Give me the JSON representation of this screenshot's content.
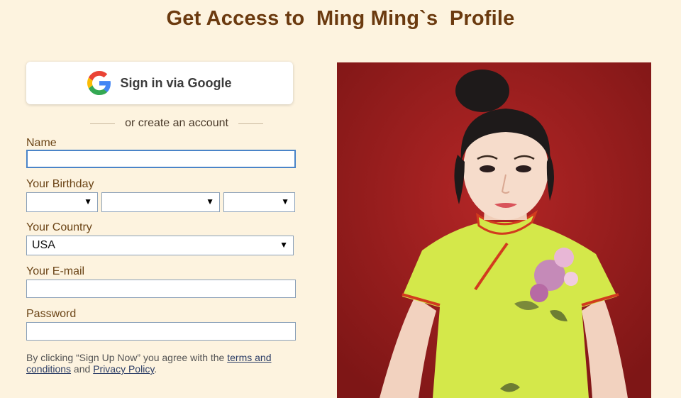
{
  "page": {
    "title": "Get Access to  Ming Ming`s  Profile"
  },
  "google": {
    "label": "Sign in via Google",
    "icon": "google-g-icon"
  },
  "divider": {
    "text": "or create an account"
  },
  "form": {
    "name": {
      "label": "Name",
      "value": ""
    },
    "birthday": {
      "label": "Your Birthday",
      "month": "",
      "day": "",
      "year": ""
    },
    "country": {
      "label": "Your Country",
      "value": "USA"
    },
    "email": {
      "label": "Your E-mail",
      "value": ""
    },
    "password": {
      "label": "Password",
      "value": ""
    }
  },
  "legal": {
    "prefix": "By clicking “Sign Up Now” you agree with the ",
    "terms_link": "terms and conditions",
    "middle": " and ",
    "privacy_link": "Privacy Policy",
    "suffix": "."
  },
  "colors": {
    "background": "#fdf3df",
    "title": "#6b3a0f",
    "photo_background": "#9a1f1f",
    "dress": "#d4e84a"
  }
}
